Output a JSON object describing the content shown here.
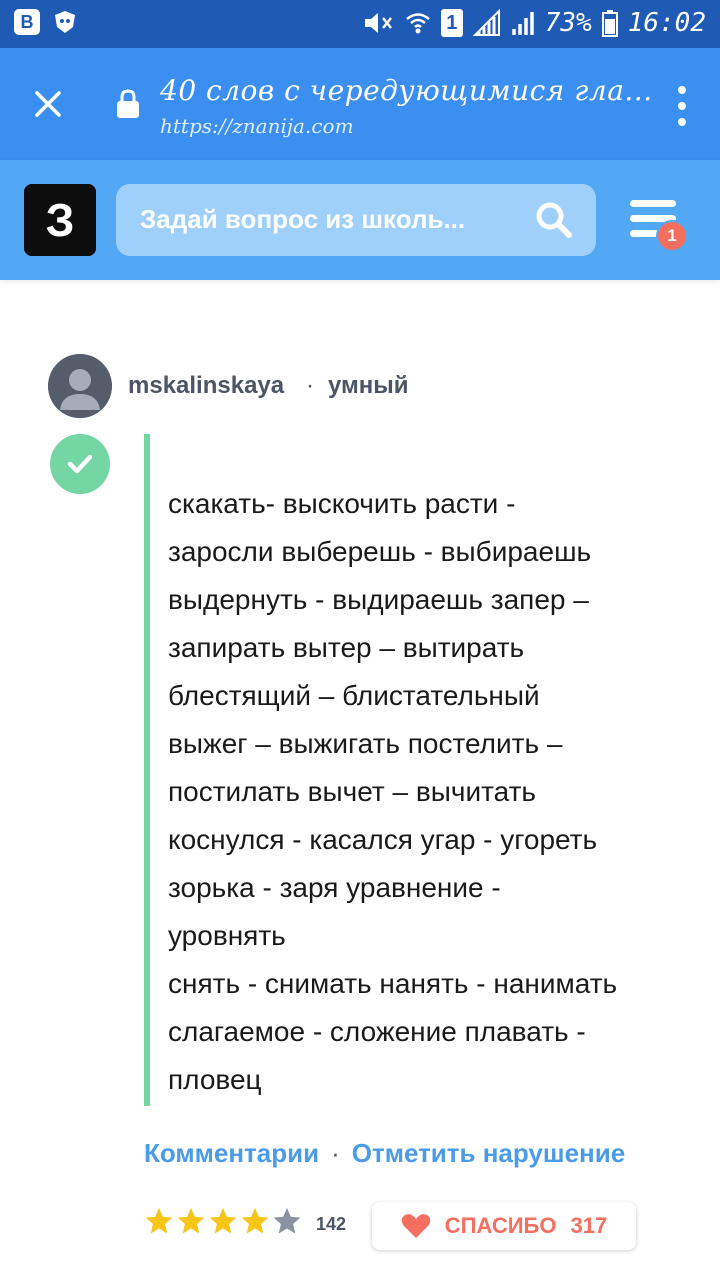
{
  "status_bar": {
    "left_icons": [
      "vk-icon",
      "dr-web-icon"
    ],
    "sim_number": "1",
    "battery": "73%",
    "time": "16:02"
  },
  "browser": {
    "title": "40 слов с чередующимися гла...",
    "url": "https://znanija.com"
  },
  "site": {
    "logo_letter": "З",
    "search_placeholder": "Задай вопрос из школь...",
    "notification_count": "1"
  },
  "answer": {
    "username": "mskalinskaya",
    "separator": "·",
    "rank": "умный",
    "text": "скакать- выскочить расти -\nзаросли выберешь - выбираешь\nвыдернуть - выдираешь запер –\nзапирать вытер – вытирать\nблестящий – блистательный\nвыжег – выжигать постелить –\nпостилать вычет – вычитать\nкоснулся - касался угар - угореть\nзорька - заря уравнение -\nуровнять\nснять - снимать нанять - нанимать\nслагаемое - сложение плавать -\nпловец",
    "comments_label": "Комментарии",
    "report_label": "Отметить нарушение",
    "links_separator": "·",
    "rating_stars": 4,
    "rating_count": "142",
    "thanks_label": "СПАСИБО",
    "thanks_count": "317"
  },
  "colors": {
    "status_bar": "#1f5bb5",
    "browser_bar": "#3b8ff0",
    "site_header": "#52a8f5",
    "accent_green": "#73d6a3",
    "link_blue": "#4a9be8",
    "thanks_red": "#f56f61",
    "star_yellow": "#f5c518"
  }
}
